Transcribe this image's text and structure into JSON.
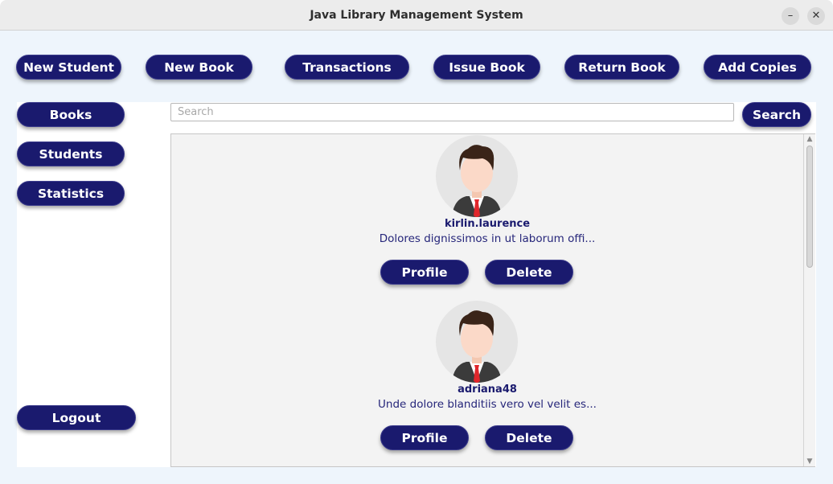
{
  "window": {
    "title": "Java Library Management System",
    "minimize_glyph": "–",
    "close_glyph": "✕"
  },
  "toolbar": {
    "new_student": "New Student",
    "new_book": "New Book",
    "transactions": "Transactions",
    "issue_book": "Issue Book",
    "return_book": "Return Book",
    "add_copies": "Add Copies"
  },
  "sidebar": {
    "books": "Books",
    "students": "Students",
    "statistics": "Statistics",
    "logout": "Logout"
  },
  "search": {
    "placeholder": "Search",
    "value": "",
    "button_label": "Search"
  },
  "students": [
    {
      "username": "kirlin.laurence",
      "description": "Dolores dignissimos in ut laborum offi...",
      "profile_label": "Profile",
      "delete_label": "Delete"
    },
    {
      "username": "adriana48",
      "description": "Unde dolore blanditiis vero vel velit es...",
      "profile_label": "Profile",
      "delete_label": "Delete"
    }
  ],
  "colors": {
    "button_bg": "#1a1a6e",
    "button_text": "#ffffff",
    "window_bg": "#eef5fc",
    "list_bg": "#f3f3f3"
  },
  "icons": {
    "avatar": "user-avatar-icon",
    "minimize": "minimize-icon",
    "close": "close-icon",
    "scroll_up": "chevron-up-icon",
    "scroll_down": "chevron-down-icon"
  }
}
